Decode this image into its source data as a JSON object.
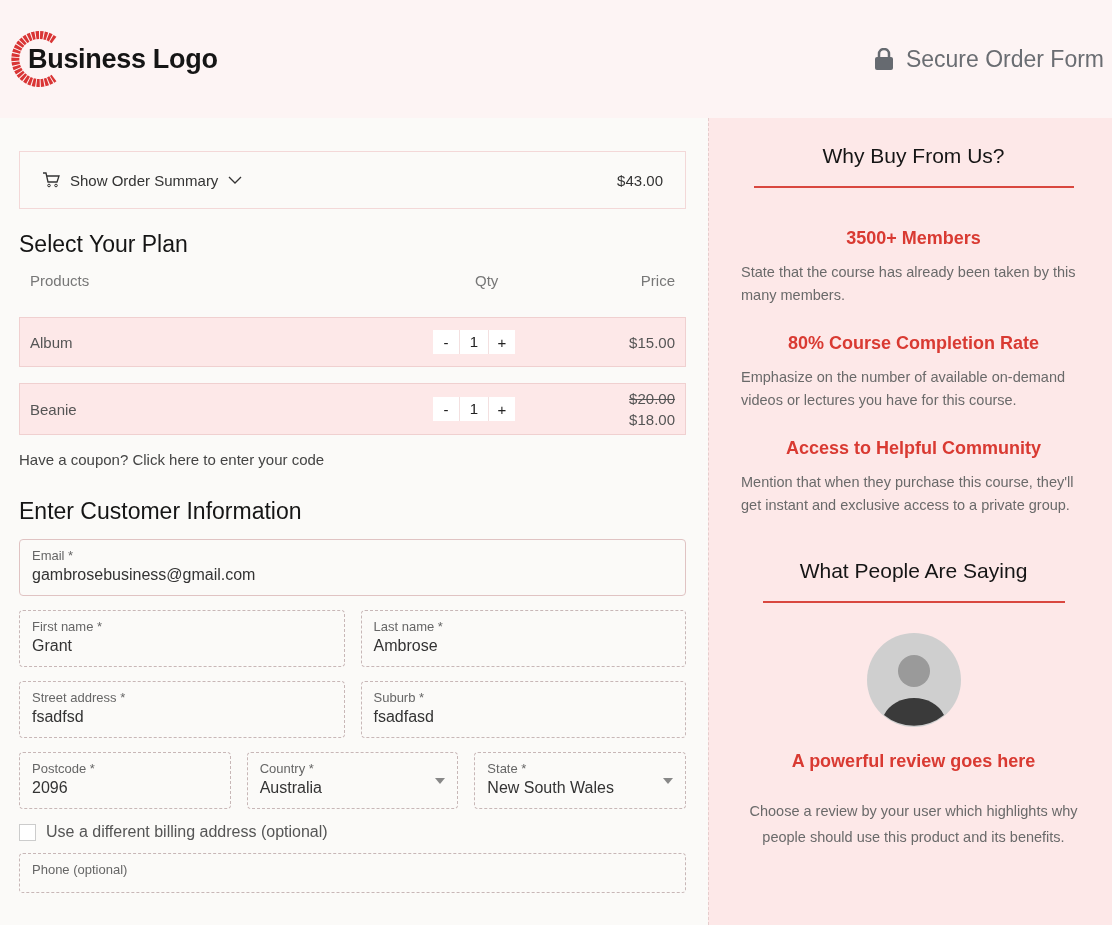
{
  "header": {
    "logo_text": "Business Logo",
    "secure_label": "Secure Order Form"
  },
  "order_summary": {
    "label": "Show Order Summary",
    "total": "$43.00"
  },
  "plan": {
    "title": "Select Your Plan",
    "columns": [
      "Products",
      "Qty",
      "Price"
    ],
    "rows": [
      {
        "name": "Album",
        "qty": "1",
        "minus": "-",
        "plus": "+",
        "price": "$15.00"
      },
      {
        "name": "Beanie",
        "qty": "1",
        "minus": "-",
        "plus": "+",
        "original_price": "$20.00",
        "price": "$18.00"
      }
    ]
  },
  "coupon": "Have a coupon? Click here to enter your code",
  "customer": {
    "title": "Enter Customer Information",
    "field_rows": [
      [
        {
          "kind": "text",
          "label": "Email *",
          "value": "gambrosebusiness@gmail.com"
        }
      ],
      [
        {
          "kind": "text",
          "label": "First name *",
          "value": "Grant"
        },
        {
          "kind": "text",
          "label": "Last name *",
          "value": "Ambrose"
        }
      ],
      [
        {
          "kind": "text",
          "label": "Street address *",
          "value": "fsadfsd"
        },
        {
          "kind": "text",
          "label": "Suburb *",
          "value": "fsadfasd"
        }
      ],
      [
        {
          "kind": "text",
          "label": "Postcode *",
          "value": "2096"
        },
        {
          "kind": "select",
          "label": "Country *",
          "value": "Australia"
        },
        {
          "kind": "select",
          "label": "State *",
          "value": "New South Wales"
        }
      ]
    ],
    "billing": {
      "label": "Use a different billing address (optional)",
      "checked": false
    },
    "phone": {
      "label": "Phone (optional)"
    }
  },
  "sidebar": {
    "title": "Why Buy From Us?",
    "features": [
      {
        "title": "3500+ Members",
        "text": "State that the course has already been taken by this many members."
      },
      {
        "title": "80% Course Completion Rate",
        "text": "Emphasize on the number of available on-demand videos or lectures you have for this course."
      },
      {
        "title": "Access to Helpful Community",
        "text": "Mention that when they purchase this course, they'll get instant and exclusive access to a private group."
      }
    ],
    "testimonial_title": "What People Are Saying",
    "review_title": "A powerful review goes here",
    "review_text": "Choose a review by your user which highlights why people should use this product and its benefits."
  }
}
